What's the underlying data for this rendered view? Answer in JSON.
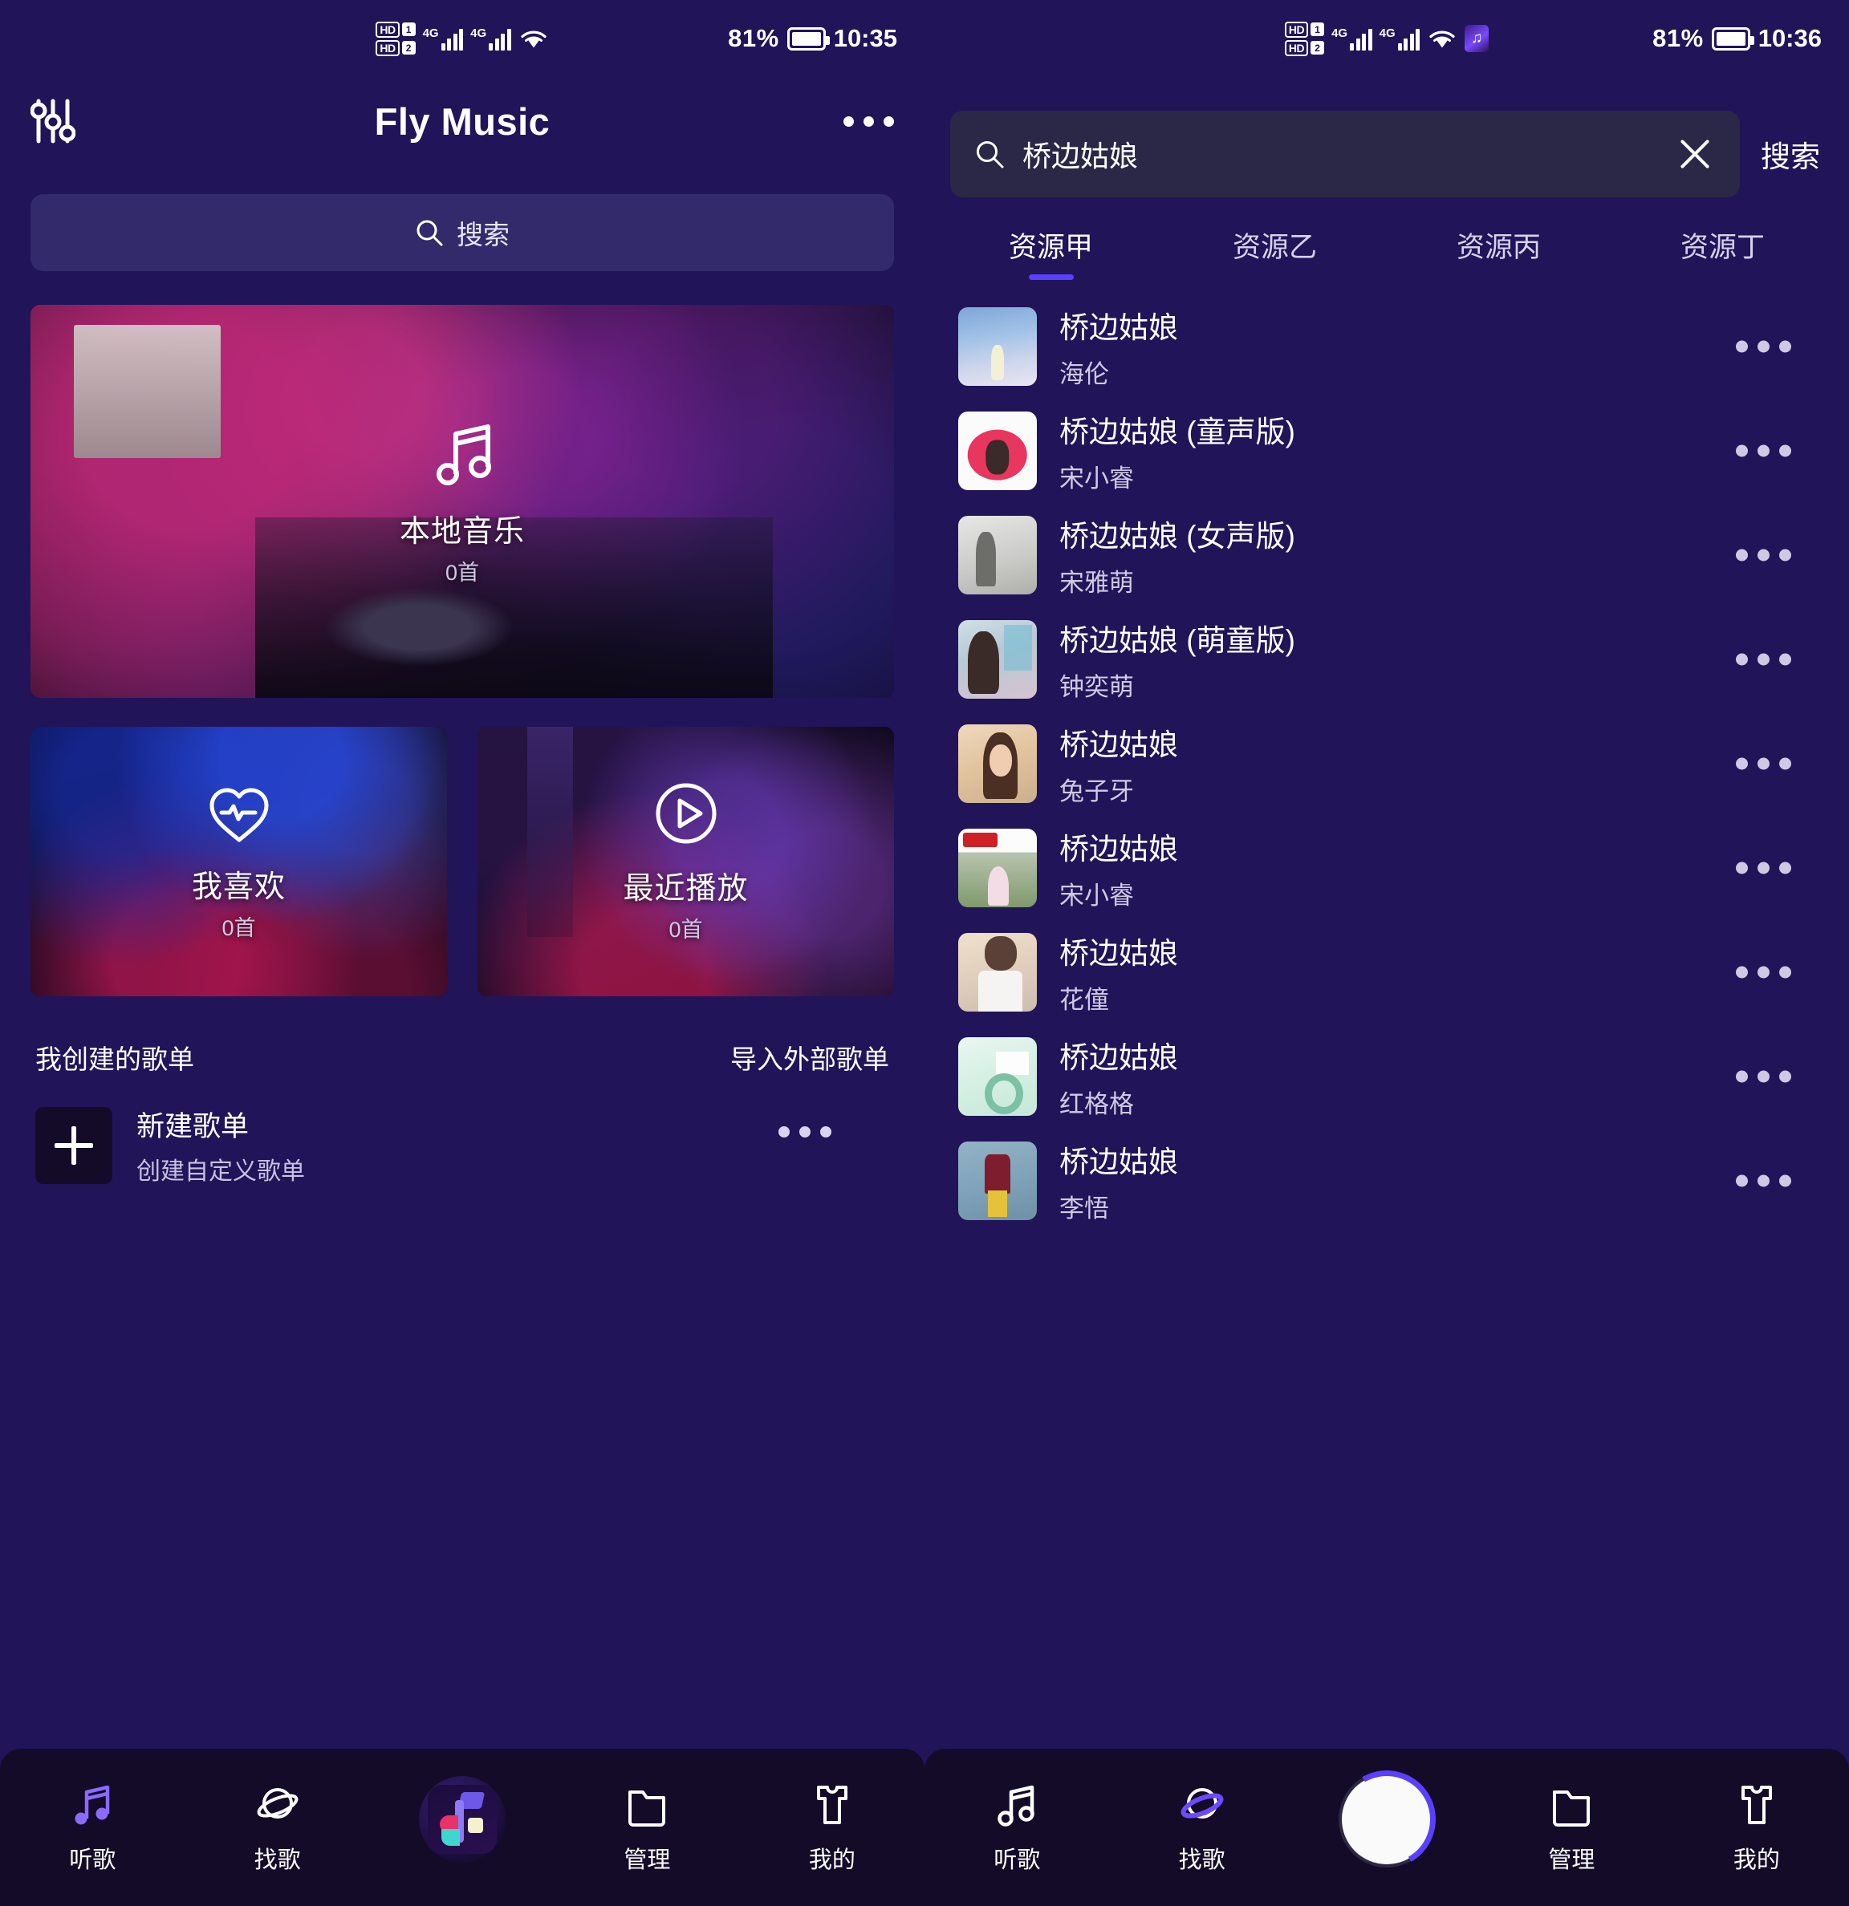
{
  "left": {
    "status": {
      "hd1": "HD",
      "hd1_num": "1",
      "hd2": "HD",
      "hd2_num": "2",
      "net1": "4G",
      "net2": "4G",
      "battery": "81%",
      "time": "10:35"
    },
    "header": {
      "title": "Fly Music",
      "eq_icon": "equalizer-icon",
      "more_icon": "more-options-icon"
    },
    "search": {
      "placeholder": "搜索",
      "icon": "search-icon"
    },
    "cards": {
      "local": {
        "title": "本地音乐",
        "count": "0首",
        "icon": "music-note-icon"
      },
      "liked": {
        "title": "我喜欢",
        "count": "0首",
        "icon": "heart-pulse-icon"
      },
      "recent": {
        "title": "最近播放",
        "count": "0首",
        "icon": "play-circle-icon"
      }
    },
    "playlists": {
      "section_title": "我创建的歌单",
      "import_action": "导入外部歌单",
      "items": [
        {
          "name": "新建歌单",
          "desc": "创建自定义歌单",
          "icon": "plus-icon"
        }
      ]
    },
    "nav": {
      "items": [
        {
          "label": "听歌",
          "icon": "music-note-icon",
          "active": true
        },
        {
          "label": "找歌",
          "icon": "planet-icon",
          "active": false
        },
        {
          "label": "",
          "icon": "app-logo-icon",
          "active": false
        },
        {
          "label": "管理",
          "icon": "folder-icon",
          "active": false
        },
        {
          "label": "我的",
          "icon": "shirt-icon",
          "active": false
        }
      ]
    }
  },
  "right": {
    "status": {
      "hd1": "HD",
      "hd1_num": "1",
      "hd2": "HD",
      "hd2_num": "2",
      "net1": "4G",
      "net2": "4G",
      "battery": "81%",
      "time": "10:36"
    },
    "search": {
      "value": "桥边姑娘",
      "placeholder": "搜索",
      "icon": "search-icon",
      "clear_icon": "close-icon",
      "button_label": "搜索"
    },
    "tabs": [
      {
        "label": "资源甲",
        "active": true
      },
      {
        "label": "资源乙",
        "active": false
      },
      {
        "label": "资源丙",
        "active": false
      },
      {
        "label": "资源丁",
        "active": false
      }
    ],
    "songs": [
      {
        "name": "桥边姑娘",
        "artist": "海伦",
        "cover": "cv-a"
      },
      {
        "name": "桥边姑娘 (童声版)",
        "artist": "宋小睿",
        "cover": "cv-b"
      },
      {
        "name": "桥边姑娘 (女声版)",
        "artist": "宋雅萌",
        "cover": "cv-c"
      },
      {
        "name": "桥边姑娘 (萌童版)",
        "artist": "钟奕萌",
        "cover": "cv-d"
      },
      {
        "name": "桥边姑娘",
        "artist": "兔子牙",
        "cover": "cv-e"
      },
      {
        "name": "桥边姑娘",
        "artist": "宋小睿",
        "cover": "cv-f"
      },
      {
        "name": "桥边姑娘",
        "artist": "花僮",
        "cover": "cv-g"
      },
      {
        "name": "桥边姑娘",
        "artist": "红格格",
        "cover": "cv-h"
      },
      {
        "name": "桥边姑娘",
        "artist": "李悟",
        "cover": "cv-i"
      }
    ],
    "nav": {
      "items": [
        {
          "label": "听歌",
          "icon": "music-note-icon",
          "active": false
        },
        {
          "label": "找歌",
          "icon": "planet-icon",
          "active": true
        },
        {
          "label": "",
          "icon": "now-playing-avatar",
          "active": false
        },
        {
          "label": "管理",
          "icon": "folder-icon",
          "active": false
        },
        {
          "label": "我的",
          "icon": "shirt-icon",
          "active": false
        }
      ]
    }
  },
  "colors": {
    "background": "#211459",
    "nav_background": "#130b28",
    "accent": "#5b3fff",
    "search_left": "#332a6b",
    "search_right": "#2b2747"
  }
}
